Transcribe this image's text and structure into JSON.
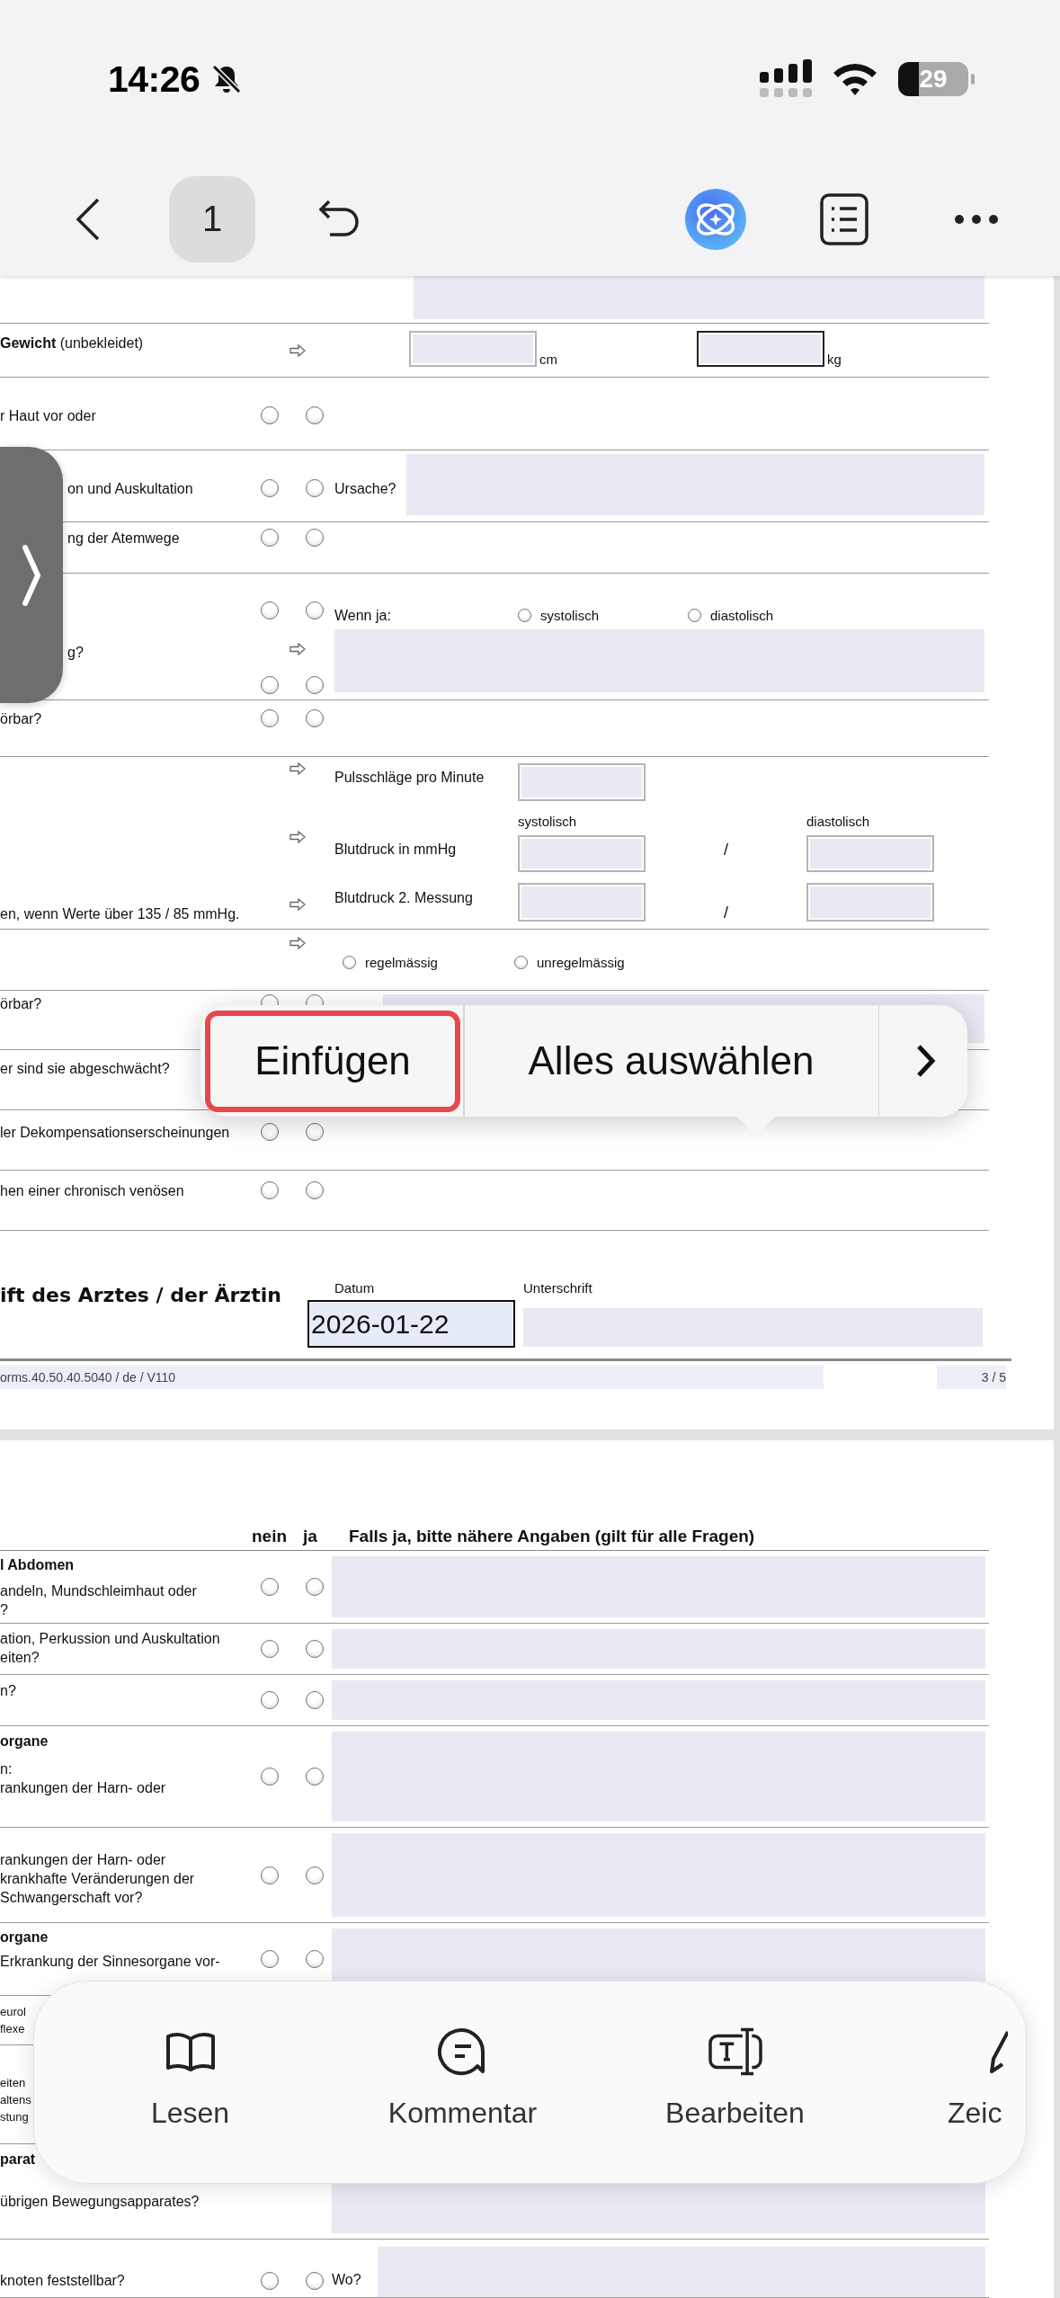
{
  "status_bar": {
    "time": "14:26",
    "battery": "29"
  },
  "nav_bar": {
    "page": "1"
  },
  "page_1": {
    "rows": [
      {
        "kind": "measure",
        "label": "**Gewicht** (unbekleidet)",
        "fields": [
          {
            "unit": "cm",
            "focused": false
          },
          {
            "unit": "kg",
            "focused": true
          }
        ]
      },
      {
        "kind": "yes_no",
        "label": "r Haut vor oder",
        "options": [
          {
            "selected": false
          },
          {
            "selected": false
          }
        ]
      },
      {
        "kind": "yes_no_field",
        "label": "on und Auskultation",
        "options": [
          {
            "selected": false
          },
          {
            "selected": false
          }
        ],
        "prompt": "Ursache?"
      },
      {
        "kind": "yes_no",
        "label": "ng der Atemwege",
        "options": [
          {
            "selected": false
          },
          {
            "selected": false
          }
        ]
      },
      {
        "kind": "choice",
        "label": "g?",
        "options": [
          {
            "selected": false
          },
          {
            "selected": false
          }
        ],
        "prompt": "Wenn ja:",
        "choices": [
          {
            "label": "systolisch",
            "selected": false
          },
          {
            "label": "diastolisch",
            "selected": false
          }
        ],
        "options_lower": [
          {
            "selected": false
          },
          {
            "selected": false
          }
        ]
      },
      {
        "kind": "yes_no",
        "label": "örbar?",
        "options": [
          {
            "selected": false
          },
          {
            "selected": false
          }
        ]
      },
      {
        "kind": "vitals",
        "label": "en, wenn Werte über 135 / 85 mmHg.",
        "pulse_label": "Pulsschläge pro Minute",
        "columns": [
          "systolisch",
          "diastolisch"
        ],
        "measurements": [
          {
            "label": "Blutdruck in mmHg",
            "separator": "/"
          },
          {
            "label": "Blutdruck 2. Messung",
            "separator": "/"
          }
        ]
      },
      {
        "kind": "rhythm",
        "choices": [
          {
            "label": "regelmässig",
            "selected": false
          },
          {
            "label": "unregelmässig",
            "selected": false
          }
        ]
      },
      {
        "kind": "yes_no_field",
        "label": "örbar?",
        "options": [
          {
            "selected": false
          },
          {
            "selected": false
          }
        ]
      },
      {
        "kind": "yes_no",
        "label": "er sind sie abgeschwächt?"
      },
      {
        "kind": "yes_no",
        "label": "ler Dekompensationserscheinungen",
        "options": [
          {
            "selected": false
          },
          {
            "selected": false
          }
        ]
      },
      {
        "kind": "yes_no",
        "label": "hen einer chronisch venösen",
        "options": [
          {
            "selected": false
          },
          {
            "selected": false
          }
        ]
      }
    ],
    "signature": {
      "title": "ift des Arztes / der Ärztin",
      "date_label": "Datum",
      "date": "2026-01-22",
      "signature_label": "Unterschrift"
    },
    "footer": {
      "form_id": "orms.40.50.40.5040 / de / V110",
      "page": "3 / 5"
    }
  },
  "page_2": {
    "columns": [
      "nein",
      "ja",
      "Falls ja, bitte nähere Angaben (gilt für alle Fragen)"
    ],
    "rows": [
      {
        "heading": "l Abdomen",
        "lines": [
          "andeln, Mundschleimhaut oder",
          "?"
        ],
        "options": [
          {
            "selected": false
          },
          {
            "selected": false
          }
        ]
      },
      {
        "lines": [
          "ation, Perkussion und Auskultation",
          "eiten?"
        ],
        "options": [
          {
            "selected": false
          },
          {
            "selected": false
          }
        ]
      },
      {
        "lines": [
          "n?"
        ],
        "options": [
          {
            "selected": false
          },
          {
            "selected": false
          }
        ]
      },
      {
        "heading": "organe",
        "lines": [
          "n:",
          "rankungen der Harn- oder"
        ],
        "options": [
          {
            "selected": false
          },
          {
            "selected": false
          }
        ]
      },
      {
        "lines": [
          "rankungen der Harn- oder",
          "krankhafte Veränderungen der",
          "Schwangerschaft vor?"
        ],
        "options": [
          {
            "selected": false
          },
          {
            "selected": false
          }
        ]
      },
      {
        "heading": "organe",
        "lines": [
          "Erkrankung der Sinnesorgane vor-"
        ],
        "options": [
          {
            "selected": false
          },
          {
            "selected": false
          }
        ]
      },
      {
        "lines": [
          "eurol",
          "flexe"
        ]
      },
      {
        "lines": [
          "eiten",
          "altens",
          "stung"
        ]
      },
      {
        "heading": "parat",
        "lines": [
          "übrigen Bewegungsapparates?"
        ]
      },
      {
        "lines": [
          "knoten feststellbar?"
        ],
        "options": [
          {
            "selected": false
          },
          {
            "selected": false
          }
        ],
        "prompt": "Wo?"
      }
    ]
  },
  "context_menu": {
    "items": [
      {
        "label": "Einfügen",
        "selected": true
      },
      {
        "label": "Alles auswählen",
        "selected": false
      }
    ]
  },
  "toolbar": {
    "items": [
      {
        "kind": "read",
        "label": "Lesen"
      },
      {
        "kind": "comment",
        "label": "Kommentar"
      },
      {
        "kind": "edit",
        "label": "Bearbeiten"
      },
      {
        "kind": "draw",
        "label": "Zeic"
      }
    ]
  }
}
